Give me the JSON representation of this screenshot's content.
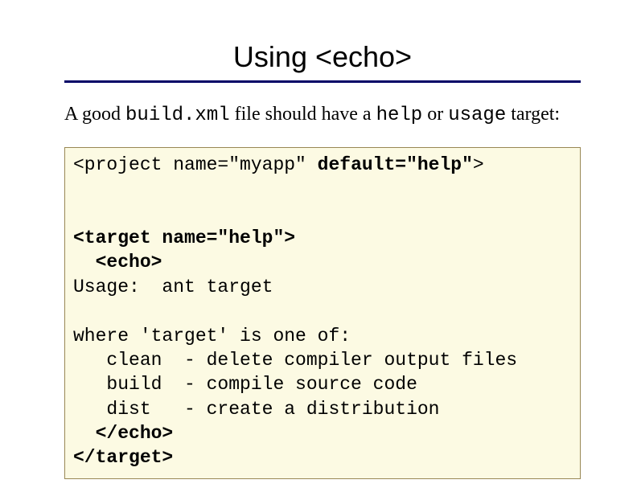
{
  "title": "Using <echo>",
  "intro": {
    "t1": "A good ",
    "t2": "build.xml",
    "t3": " file should have a ",
    "t4": "help",
    "t5": " or ",
    "t6": "usage",
    "t7": " target:"
  },
  "code": {
    "l1a": "<project name=\"myapp\" ",
    "l1b": "default=\"help\"",
    "l1c": ">",
    "blank1": "",
    "blank2": "",
    "l2": "<target name=\"help\">",
    "l3": "  <echo>",
    "l4": "Usage:  ant target",
    "blank3": "",
    "l5": "where 'target' is one of:",
    "l6": "   clean  - delete compiler output files",
    "l7": "   build  - compile source code",
    "l8": "   dist   - create a distribution",
    "l9": "  </echo>",
    "l10": "</target>"
  }
}
